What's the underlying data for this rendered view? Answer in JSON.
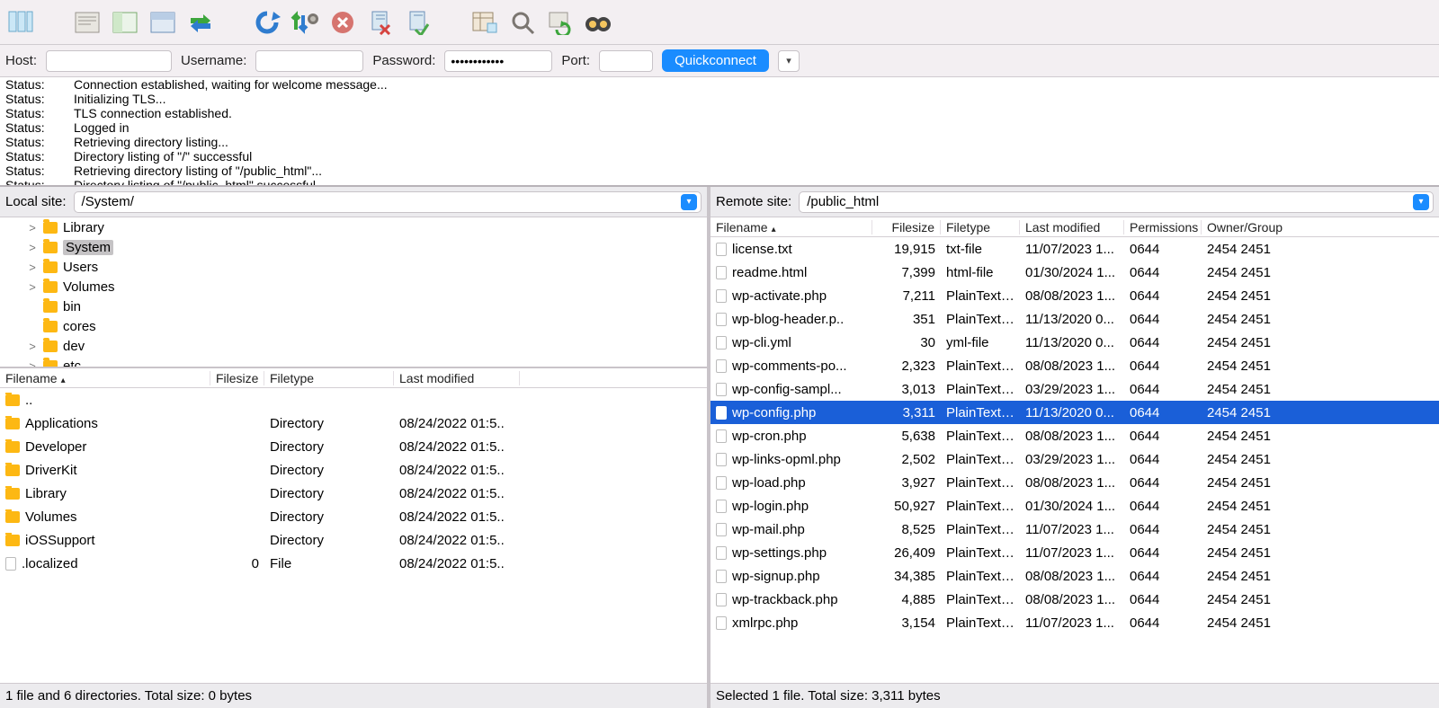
{
  "conn": {
    "host_label": "Host:",
    "user_label": "Username:",
    "pass_label": "Password:",
    "port_label": "Port:",
    "pass_mask": "••••••••••••",
    "quick_label": "Quickconnect"
  },
  "log": [
    {
      "t": "Status:",
      "m": "Connection established, waiting for welcome message..."
    },
    {
      "t": "Status:",
      "m": "Initializing TLS..."
    },
    {
      "t": "Status:",
      "m": "TLS connection established."
    },
    {
      "t": "Status:",
      "m": "Logged in"
    },
    {
      "t": "Status:",
      "m": "Retrieving directory listing..."
    },
    {
      "t": "Status:",
      "m": "Directory listing of \"/\" successful"
    },
    {
      "t": "Status:",
      "m": "Retrieving directory listing of \"/public_html\"..."
    },
    {
      "t": "Status:",
      "m": "Directory listing of \"/public_html\" successful"
    }
  ],
  "local": {
    "label": "Local site:",
    "path": "/System/",
    "tree": [
      {
        "exp": ">",
        "name": "Library",
        "sel": false
      },
      {
        "exp": ">",
        "name": "System",
        "sel": true
      },
      {
        "exp": ">",
        "name": "Users",
        "sel": false
      },
      {
        "exp": ">",
        "name": "Volumes",
        "sel": false
      },
      {
        "exp": "",
        "name": "bin",
        "sel": false
      },
      {
        "exp": "",
        "name": "cores",
        "sel": false
      },
      {
        "exp": ">",
        "name": "dev",
        "sel": false
      },
      {
        "exp": ">",
        "name": "etc",
        "sel": false
      }
    ],
    "headers": {
      "name": "Filename",
      "size": "Filesize",
      "type": "Filetype",
      "mod": "Last modified"
    },
    "rows": [
      {
        "name": "..",
        "size": "",
        "type": "",
        "mod": "",
        "icon": "folder"
      },
      {
        "name": "Applications",
        "size": "",
        "type": "Directory",
        "mod": "08/24/2022 01:5..",
        "icon": "folder"
      },
      {
        "name": "Developer",
        "size": "",
        "type": "Directory",
        "mod": "08/24/2022 01:5..",
        "icon": "folder"
      },
      {
        "name": "DriverKit",
        "size": "",
        "type": "Directory",
        "mod": "08/24/2022 01:5..",
        "icon": "folder"
      },
      {
        "name": "Library",
        "size": "",
        "type": "Directory",
        "mod": "08/24/2022 01:5..",
        "icon": "folder"
      },
      {
        "name": "Volumes",
        "size": "",
        "type": "Directory",
        "mod": "08/24/2022 01:5..",
        "icon": "folder"
      },
      {
        "name": "iOSSupport",
        "size": "",
        "type": "Directory",
        "mod": "08/24/2022 01:5..",
        "icon": "folder"
      },
      {
        "name": ".localized",
        "size": "0",
        "type": "File",
        "mod": "08/24/2022 01:5..",
        "icon": "file"
      }
    ],
    "status": "1 file and 6 directories. Total size: 0 bytes"
  },
  "remote": {
    "label": "Remote site:",
    "path": "/public_html",
    "headers": {
      "name": "Filename",
      "size": "Filesize",
      "type": "Filetype",
      "mod": "Last modified",
      "perm": "Permissions",
      "own": "Owner/Group"
    },
    "rows": [
      {
        "name": "license.txt",
        "size": "19,915",
        "type": "txt-file",
        "mod": "11/07/2023 1...",
        "perm": "0644",
        "own": "2454 2451",
        "sel": false
      },
      {
        "name": "readme.html",
        "size": "7,399",
        "type": "html-file",
        "mod": "01/30/2024 1...",
        "perm": "0644",
        "own": "2454 2451",
        "sel": false
      },
      {
        "name": "wp-activate.php",
        "size": "7,211",
        "type": "PlainTextT..",
        "mod": "08/08/2023 1...",
        "perm": "0644",
        "own": "2454 2451",
        "sel": false
      },
      {
        "name": "wp-blog-header.p..",
        "size": "351",
        "type": "PlainTextT..",
        "mod": "11/13/2020 0...",
        "perm": "0644",
        "own": "2454 2451",
        "sel": false
      },
      {
        "name": "wp-cli.yml",
        "size": "30",
        "type": "yml-file",
        "mod": "11/13/2020 0...",
        "perm": "0644",
        "own": "2454 2451",
        "sel": false
      },
      {
        "name": "wp-comments-po...",
        "size": "2,323",
        "type": "PlainTextT..",
        "mod": "08/08/2023 1...",
        "perm": "0644",
        "own": "2454 2451",
        "sel": false
      },
      {
        "name": "wp-config-sampl...",
        "size": "3,013",
        "type": "PlainTextT..",
        "mod": "03/29/2023 1...",
        "perm": "0644",
        "own": "2454 2451",
        "sel": false
      },
      {
        "name": "wp-config.php",
        "size": "3,311",
        "type": "PlainTextT..",
        "mod": "11/13/2020 0...",
        "perm": "0644",
        "own": "2454 2451",
        "sel": true
      },
      {
        "name": "wp-cron.php",
        "size": "5,638",
        "type": "PlainTextT..",
        "mod": "08/08/2023 1...",
        "perm": "0644",
        "own": "2454 2451",
        "sel": false
      },
      {
        "name": "wp-links-opml.php",
        "size": "2,502",
        "type": "PlainTextT..",
        "mod": "03/29/2023 1...",
        "perm": "0644",
        "own": "2454 2451",
        "sel": false
      },
      {
        "name": "wp-load.php",
        "size": "3,927",
        "type": "PlainTextT..",
        "mod": "08/08/2023 1...",
        "perm": "0644",
        "own": "2454 2451",
        "sel": false
      },
      {
        "name": "wp-login.php",
        "size": "50,927",
        "type": "PlainTextT..",
        "mod": "01/30/2024 1...",
        "perm": "0644",
        "own": "2454 2451",
        "sel": false
      },
      {
        "name": "wp-mail.php",
        "size": "8,525",
        "type": "PlainTextT..",
        "mod": "11/07/2023 1...",
        "perm": "0644",
        "own": "2454 2451",
        "sel": false
      },
      {
        "name": "wp-settings.php",
        "size": "26,409",
        "type": "PlainTextT..",
        "mod": "11/07/2023 1...",
        "perm": "0644",
        "own": "2454 2451",
        "sel": false
      },
      {
        "name": "wp-signup.php",
        "size": "34,385",
        "type": "PlainTextT..",
        "mod": "08/08/2023 1...",
        "perm": "0644",
        "own": "2454 2451",
        "sel": false
      },
      {
        "name": "wp-trackback.php",
        "size": "4,885",
        "type": "PlainTextT..",
        "mod": "08/08/2023 1...",
        "perm": "0644",
        "own": "2454 2451",
        "sel": false
      },
      {
        "name": "xmlrpc.php",
        "size": "3,154",
        "type": "PlainTextT..",
        "mod": "11/07/2023 1...",
        "perm": "0644",
        "own": "2454 2451",
        "sel": false
      }
    ],
    "status": "Selected 1 file. Total size: 3,311 bytes"
  }
}
